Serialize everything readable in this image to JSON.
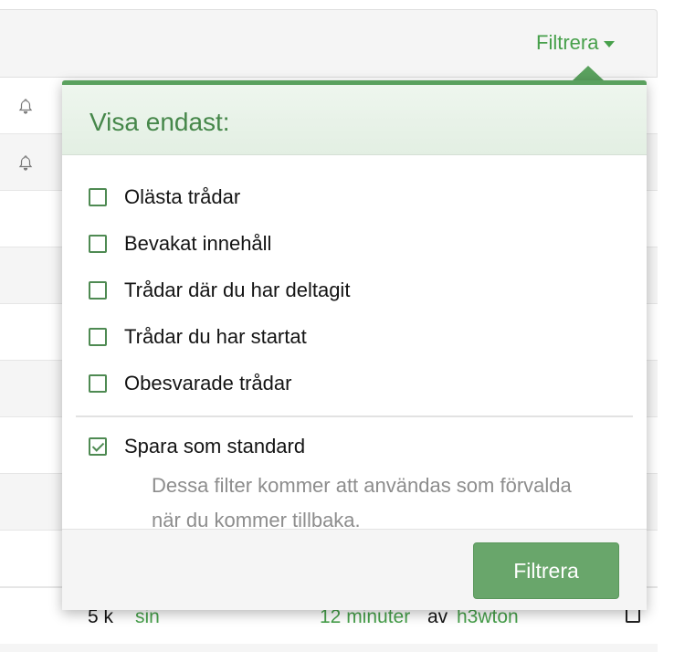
{
  "trigger": {
    "label": "Filtrera"
  },
  "popup": {
    "title": "Visa endast:",
    "options": [
      {
        "label": "Olästa trådar",
        "checked": false
      },
      {
        "label": "Bevakat innehåll",
        "checked": false
      },
      {
        "label": "Trådar där du har deltagit",
        "checked": false
      },
      {
        "label": "Trådar du har startat",
        "checked": false
      },
      {
        "label": "Obesvarade trådar",
        "checked": false
      }
    ],
    "save_default": {
      "label": "Spara som standard",
      "checked": true
    },
    "hint": "Dessa filter kommer att användas som förvalda när du kommer tillbaka.",
    "button": "Filtrera"
  },
  "bottom_row": {
    "count": "5 k",
    "count_user": "sin",
    "time": "12 minuter",
    "by": "av",
    "user": "h3wton"
  },
  "colors": {
    "accent": "#47a04b",
    "button": "#69a66b"
  }
}
